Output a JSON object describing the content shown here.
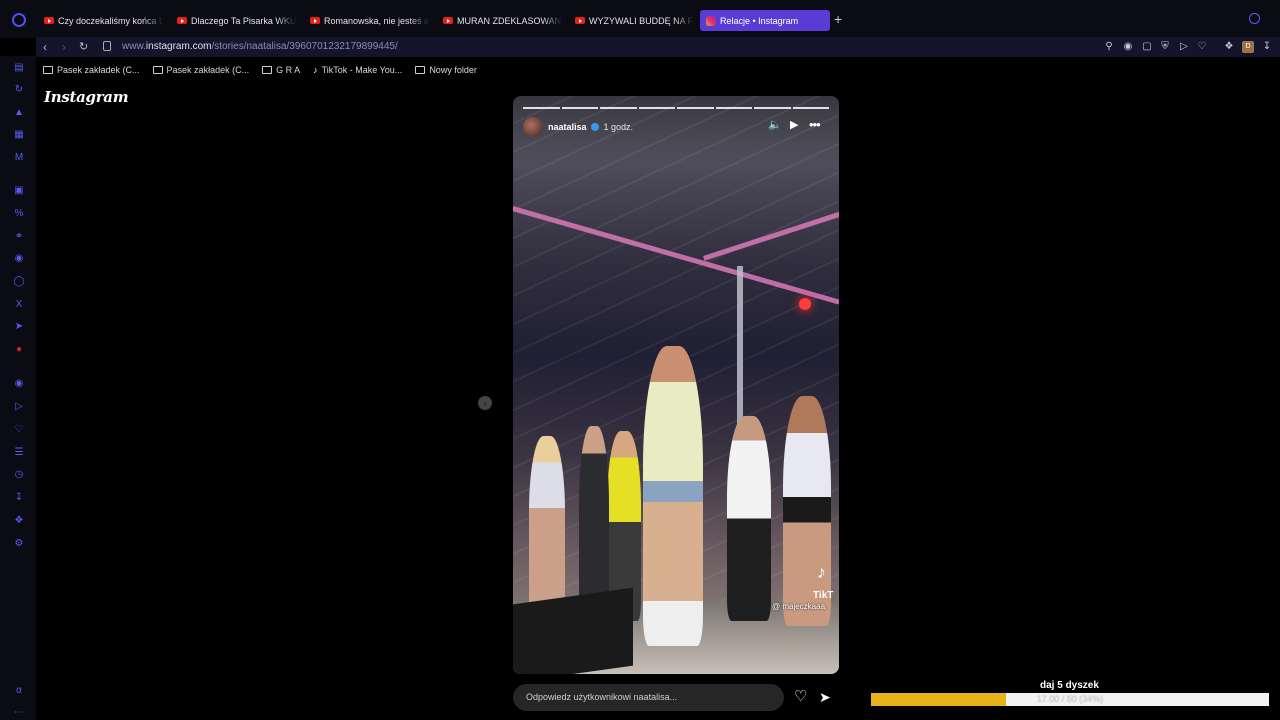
{
  "browser": {
    "tabs": [
      {
        "label": "Czy doczekaliśmy końca U",
        "active": false,
        "icon": "youtube-icon"
      },
      {
        "label": "Dlaczego Ta Pisarka WKUR",
        "active": false,
        "icon": "youtube-icon"
      },
      {
        "label": "Romanowska, nie jesteś ar",
        "active": false,
        "icon": "youtube-icon"
      },
      {
        "label": "MURAN ZDEKLASOWANY",
        "active": false,
        "icon": "youtube-icon"
      },
      {
        "label": "WYZYWALI BUDDĘ NA FE",
        "active": false,
        "icon": "youtube-icon"
      },
      {
        "label": "Relacje • Instagram",
        "active": true,
        "icon": "instagram-icon"
      }
    ],
    "new_tab_symbol": "+",
    "url_prefix": "www.",
    "url_host": "instagram.com",
    "url_path": "/stories/naatalisa/3960701232179899445/",
    "bookmarks": [
      {
        "label": "Pasek zakładek (C...",
        "icon": "folder-icon"
      },
      {
        "label": "Pasek zakładek (C...",
        "icon": "folder-icon"
      },
      {
        "label": "G R A",
        "icon": "folder-icon"
      },
      {
        "label": "TikTok - Make You...",
        "icon": "tiktok-icon"
      },
      {
        "label": "Nowy folder",
        "icon": "folder-icon"
      }
    ],
    "accent": "#5b3bd6"
  },
  "instagram": {
    "logo": "Instagram",
    "story": {
      "username": "naatalisa",
      "time_ago": "1 godz.",
      "segments": 8,
      "watermark": "@ majeczkaaa",
      "tiktok_mark": "TikT"
    },
    "reply_placeholder": "Odpowiedz użytkownikowi naatalisa..."
  },
  "goal_widget": {
    "title": "daj 5 dyszek",
    "progress_text": "17.00 / 50 (34%)",
    "progress_fraction": 0.34,
    "fill_color": "#e8b21a"
  }
}
